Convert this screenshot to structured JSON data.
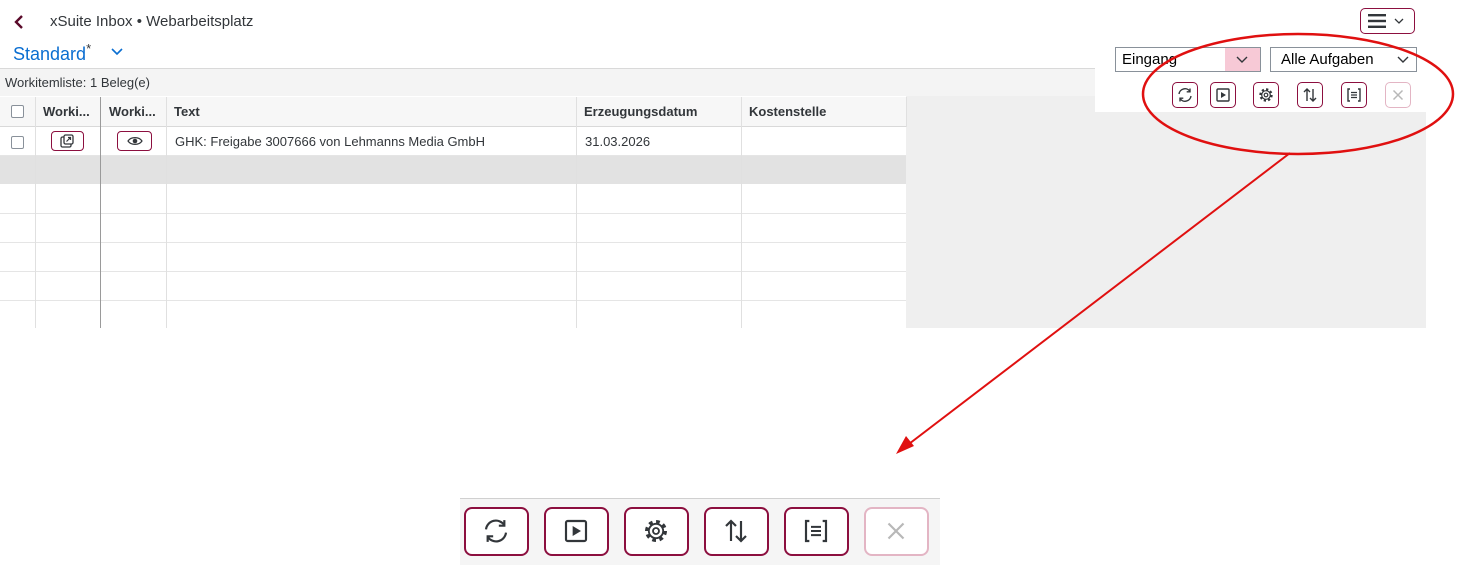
{
  "header": {
    "title": "xSuite Inbox • Webarbeitsplatz",
    "variant": "Standard",
    "variant_modified": "*"
  },
  "filters": {
    "folder": "Eingang",
    "task_filter": "Alle Aufgaben"
  },
  "list": {
    "count_label": "Workitemliste: 1 Beleg(e)",
    "columns": [
      "Worki...",
      "Worki...",
      "Text",
      "Erzeugungsdatum",
      "Kostenstelle"
    ],
    "rows": [
      {
        "text": "GHK: Freigabe 3007666 von Lehmanns Media GmbH",
        "date": "31.03.2026",
        "cost_center": ""
      }
    ]
  },
  "toolbar": {
    "buttons": [
      "refresh-icon",
      "play-icon",
      "settings-icon",
      "sort-icon",
      "group-icon",
      "close-icon"
    ],
    "disabled": [
      "close-icon"
    ]
  },
  "colors": {
    "accent": "#8c0f3f",
    "link": "#0a6ed1",
    "annotation": "#e01010"
  }
}
